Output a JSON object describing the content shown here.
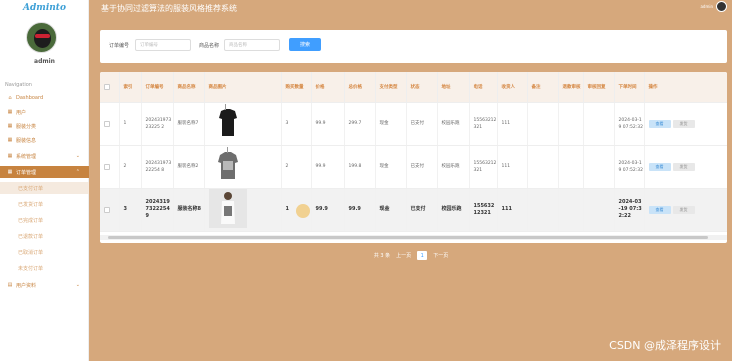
{
  "app": {
    "logo": "Adminto",
    "title": "基于协同过滤算法的服装风格推荐系统",
    "user": "admin"
  },
  "profile": {
    "name": "admin"
  },
  "nav": {
    "section_label": "Navigation",
    "items": [
      {
        "label": "Dashboard",
        "icon": "home-icon"
      },
      {
        "label": "用户",
        "icon": "grid-icon"
      },
      {
        "label": "服装分类",
        "icon": "grid-icon"
      },
      {
        "label": "服装信息",
        "icon": "grid-icon"
      },
      {
        "label": "系统管理",
        "icon": "grid-icon"
      },
      {
        "label": "订单管理",
        "icon": "grid-icon"
      }
    ],
    "order_sub": [
      "已支付订单",
      "已发货订单",
      "已完成订单",
      "已退款订单",
      "已取消订单",
      "未支付订单"
    ],
    "last_group": {
      "label": "用户资料",
      "icon": "document-icon"
    }
  },
  "search": {
    "order_label": "订单编号",
    "order_placeholder": "订单编号",
    "product_label": "商品名称",
    "product_placeholder": "商品名称",
    "button": "搜索"
  },
  "table": {
    "headers": [
      "索引",
      "订单编号",
      "商品名称",
      "商品图片",
      "购买数量",
      "价格",
      "总价格",
      "支付类型",
      "状态",
      "地址",
      "电话",
      "收货人",
      "备注",
      "退款审核",
      "审核回复",
      "下单时间",
      "操作"
    ],
    "rows": [
      {
        "index": "1",
        "order_no": "20243197323225 2",
        "product": "服装名称7",
        "qty": "3",
        "price": "99.9",
        "total": "299.7",
        "pay": "现金",
        "status": "已支付",
        "address": "校园乐跑",
        "phone": "15563212321",
        "receiver": "111",
        "note": "",
        "refund": "",
        "reply": "",
        "time": "2024-03-19 07:52:32",
        "view": "查看",
        "delete": "发货"
      },
      {
        "index": "2",
        "order_no": "20243197322254 8",
        "product": "服装名称2",
        "qty": "2",
        "price": "99.9",
        "total": "199.8",
        "pay": "现金",
        "status": "已支付",
        "address": "校园乐跑",
        "phone": "15563212321",
        "receiver": "111",
        "note": "",
        "refund": "",
        "reply": "",
        "time": "2024-03-19 07:52:32",
        "view": "查看",
        "delete": "发货"
      },
      {
        "index": "3",
        "order_no": "202431973222549",
        "product": "服装名称8",
        "qty": "1",
        "price": "99.9",
        "total": "99.9",
        "pay": "现金",
        "status": "已支付",
        "address": "校园乐跑",
        "phone": "15563212321",
        "receiver": "111",
        "note": "",
        "refund": "",
        "reply": "",
        "time": "2024-03-19 07:32:22",
        "view": "查看",
        "delete": "发货"
      }
    ]
  },
  "pagination": {
    "total": "共 3 条",
    "prev": "上一页",
    "page": "1",
    "next": "下一页"
  },
  "watermark": "CSDN @成泽程序设计"
}
